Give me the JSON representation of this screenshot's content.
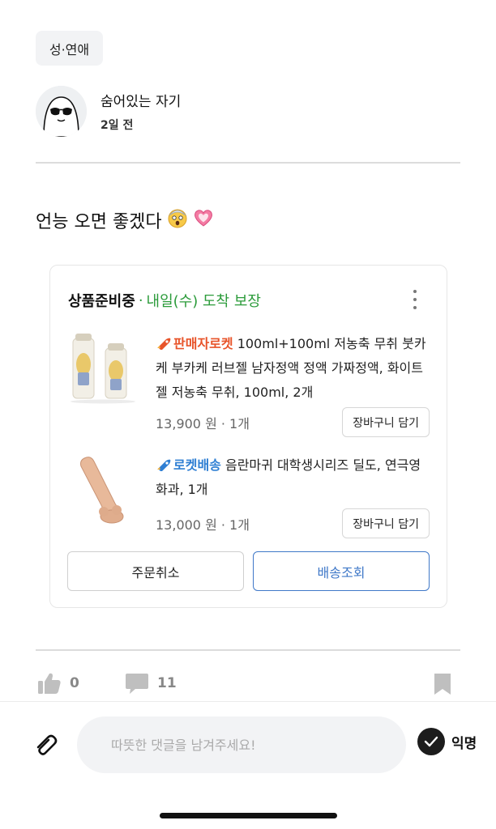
{
  "post": {
    "category": "성·연애",
    "author_name": "숨어있는 자기",
    "time_ago": "2일 전",
    "body_text": "언능 오면 좋겠다"
  },
  "order": {
    "status": "상품준비중",
    "arrival_dot": "·",
    "arrival": "내일(수) 도착 보장",
    "products": [
      {
        "badge": "판매자로켓",
        "title": " 100ml+100ml 저농축 무취 붓카케 부카케 러브젤 남자정액 정액 가짜정액, 화이트 젤 저농축 무취, 100ml, 2개",
        "price": "13,900 원 · 1개",
        "cart_label": "장바구니 담기"
      },
      {
        "badge": "로켓배송",
        "title": " 음란마귀 대학생시리즈 딜도, 연극영화과, 1개",
        "price": "13,000 원 · 1개",
        "cart_label": "장바구니 담기"
      }
    ],
    "cancel_label": "주문취소",
    "track_label": "배송조회"
  },
  "reactions": {
    "likes": "0",
    "comments": "11"
  },
  "composer": {
    "placeholder": "따뜻한 댓글을 남겨주세요!",
    "anon_label": "익명"
  },
  "colors": {
    "arrival_green": "#2b9b3a",
    "seller_orange": "#e8542a",
    "rocket_blue": "#2f7fd3",
    "track_blue": "#3f78c8"
  },
  "icons": [
    "avatar-sunglasses-icon",
    "shocked-emoji-icon",
    "heart-emoji-icon",
    "rocket-icon",
    "kebab-menu-icon",
    "thumbs-up-icon",
    "comment-icon",
    "bookmark-icon",
    "paperclip-icon",
    "check-icon"
  ]
}
